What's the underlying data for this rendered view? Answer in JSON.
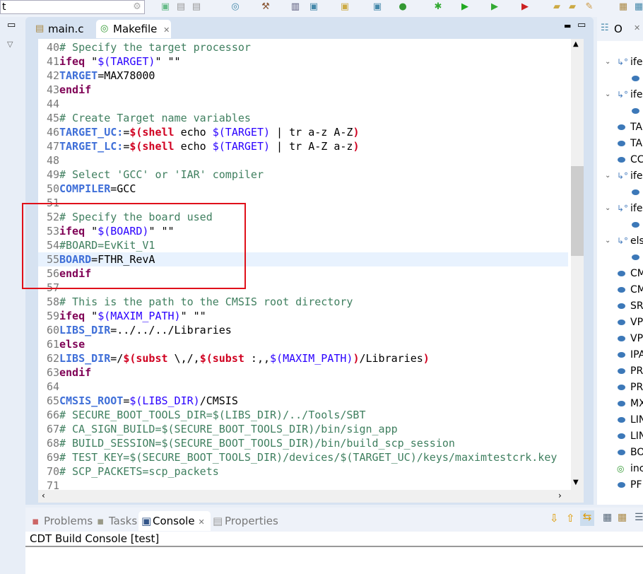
{
  "toolbar": {
    "quick_access_value": "t"
  },
  "editor": {
    "tabs": [
      {
        "label": "main.c",
        "icon": "c-file-icon"
      },
      {
        "label": "Makefile",
        "icon": "makefile-icon",
        "active": true
      }
    ],
    "current_line": 55,
    "lines": [
      {
        "n": "40",
        "t": [
          [
            "cmt",
            "# Specify the target processor"
          ]
        ]
      },
      {
        "n": "41",
        "t": [
          [
            "kw",
            "ifeq"
          ],
          [
            "txt",
            " \""
          ],
          [
            "ref",
            "$(TARGET)"
          ],
          [
            "txt",
            "\" \"\""
          ]
        ]
      },
      {
        "n": "42",
        "t": [
          [
            "var",
            "TARGET"
          ],
          [
            "txt",
            "=MAX78000"
          ]
        ]
      },
      {
        "n": "43",
        "t": [
          [
            "kw",
            "endif"
          ]
        ]
      },
      {
        "n": "44",
        "t": []
      },
      {
        "n": "45",
        "t": [
          [
            "cmt",
            "# Create Target name variables"
          ]
        ]
      },
      {
        "n": "46",
        "t": [
          [
            "var",
            "TARGET_UC:"
          ],
          [
            "txt",
            "="
          ],
          [
            "fn",
            "$(shell"
          ],
          [
            "txt",
            " echo "
          ],
          [
            "ref",
            "$(TARGET)"
          ],
          [
            "txt",
            " | tr a-z A-Z"
          ],
          [
            "fn",
            ")"
          ]
        ]
      },
      {
        "n": "47",
        "t": [
          [
            "var",
            "TARGET_LC:"
          ],
          [
            "txt",
            "="
          ],
          [
            "fn",
            "$(shell"
          ],
          [
            "txt",
            " echo "
          ],
          [
            "ref",
            "$(TARGET)"
          ],
          [
            "txt",
            " | tr A-Z a-z"
          ],
          [
            "fn",
            ")"
          ]
        ]
      },
      {
        "n": "48",
        "t": []
      },
      {
        "n": "49",
        "t": [
          [
            "cmt",
            "# Select 'GCC' or 'IAR' compiler"
          ]
        ]
      },
      {
        "n": "50",
        "t": [
          [
            "var",
            "COMPILER"
          ],
          [
            "txt",
            "=GCC"
          ]
        ]
      },
      {
        "n": "51",
        "t": []
      },
      {
        "n": "52",
        "t": [
          [
            "cmt",
            "# Specify the board used"
          ]
        ]
      },
      {
        "n": "53",
        "t": [
          [
            "kw",
            "ifeq"
          ],
          [
            "txt",
            " \""
          ],
          [
            "ref",
            "$(BOARD)"
          ],
          [
            "txt",
            "\" \"\""
          ]
        ]
      },
      {
        "n": "54",
        "t": [
          [
            "cmt",
            "#BOARD=EvKit_V1"
          ]
        ]
      },
      {
        "n": "55",
        "t": [
          [
            "var",
            "BOARD"
          ],
          [
            "txt",
            "=FTHR_RevA"
          ]
        ]
      },
      {
        "n": "56",
        "t": [
          [
            "kw",
            "endif"
          ]
        ]
      },
      {
        "n": "57",
        "t": []
      },
      {
        "n": "58",
        "t": [
          [
            "cmt",
            "# This is the path to the CMSIS root directory"
          ]
        ]
      },
      {
        "n": "59",
        "t": [
          [
            "kw",
            "ifeq"
          ],
          [
            "txt",
            " \""
          ],
          [
            "ref",
            "$(MAXIM_PATH)"
          ],
          [
            "txt",
            "\" \"\""
          ]
        ]
      },
      {
        "n": "60",
        "t": [
          [
            "var",
            "LIBS_DIR"
          ],
          [
            "txt",
            "=../../../Libraries"
          ]
        ]
      },
      {
        "n": "61",
        "t": [
          [
            "kw",
            "else"
          ]
        ]
      },
      {
        "n": "62",
        "t": [
          [
            "var",
            "LIBS_DIR"
          ],
          [
            "txt",
            "=/"
          ],
          [
            "fn",
            "$(subst"
          ],
          [
            "txt",
            " \\,/,"
          ],
          [
            "fn",
            "$(subst"
          ],
          [
            "txt",
            " :,,"
          ],
          [
            "ref",
            "$(MAXIM_PATH)"
          ],
          [
            "fn",
            ")"
          ],
          [
            "txt",
            "/Libraries"
          ],
          [
            "fn",
            ")"
          ]
        ]
      },
      {
        "n": "63",
        "t": [
          [
            "kw",
            "endif"
          ]
        ]
      },
      {
        "n": "64",
        "t": []
      },
      {
        "n": "65",
        "t": [
          [
            "var",
            "CMSIS_ROOT"
          ],
          [
            "txt",
            "="
          ],
          [
            "ref",
            "$(LIBS_DIR)"
          ],
          [
            "txt",
            "/CMSIS"
          ]
        ]
      },
      {
        "n": "66",
        "t": [
          [
            "cmt",
            "# SECURE_BOOT_TOOLS_DIR=$(LIBS_DIR)/../Tools/SBT"
          ]
        ]
      },
      {
        "n": "67",
        "t": [
          [
            "cmt",
            "# CA_SIGN_BUILD=$(SECURE_BOOT_TOOLS_DIR)/bin/sign_app"
          ]
        ]
      },
      {
        "n": "68",
        "t": [
          [
            "cmt",
            "# BUILD_SESSION=$(SECURE_BOOT_TOOLS_DIR)/bin/build_scp_session"
          ]
        ]
      },
      {
        "n": "69",
        "t": [
          [
            "cmt",
            "# TEST_KEY=$(SECURE_BOOT_TOOLS_DIR)/devices/$(TARGET_UC)/keys/maximtestcrk.key"
          ]
        ]
      },
      {
        "n": "70",
        "t": [
          [
            "cmt",
            "# SCP_PACKETS=scp_packets"
          ]
        ]
      },
      {
        "n": "71",
        "t": []
      }
    ]
  },
  "outline": {
    "title": "O",
    "items": [
      {
        "type": "cond",
        "label": "ife"
      },
      {
        "type": "var",
        "label": ""
      },
      {
        "type": "cond",
        "label": "ife"
      },
      {
        "type": "var",
        "label": ""
      },
      {
        "type": "var",
        "label": "TA",
        "top": true
      },
      {
        "type": "var",
        "label": "TA",
        "top": true
      },
      {
        "type": "var",
        "label": "CC",
        "top": true
      },
      {
        "type": "cond",
        "label": "ife"
      },
      {
        "type": "var",
        "label": ""
      },
      {
        "type": "cond",
        "label": "ife"
      },
      {
        "type": "var",
        "label": ""
      },
      {
        "type": "cond",
        "label": "els"
      },
      {
        "type": "var",
        "label": ""
      },
      {
        "type": "var",
        "label": "CM",
        "top": true
      },
      {
        "type": "var",
        "label": "CM",
        "top": true
      },
      {
        "type": "var",
        "label": "SR",
        "top": true
      },
      {
        "type": "var",
        "label": "VP",
        "top": true
      },
      {
        "type": "var",
        "label": "VP",
        "top": true
      },
      {
        "type": "var",
        "label": "IPA",
        "top": true
      },
      {
        "type": "var",
        "label": "PR",
        "top": true
      },
      {
        "type": "var",
        "label": "PR",
        "top": true
      },
      {
        "type": "var",
        "label": "MX",
        "top": true
      },
      {
        "type": "var",
        "label": "LIN",
        "top": true
      },
      {
        "type": "var",
        "label": "LIN",
        "top": true
      },
      {
        "type": "var",
        "label": "BO",
        "top": true
      },
      {
        "type": "include",
        "label": "inc",
        "top": true
      },
      {
        "type": "var",
        "label": "PF",
        "top": true
      }
    ]
  },
  "bottom": {
    "tabs": [
      {
        "label": "Problems"
      },
      {
        "label": "Tasks"
      },
      {
        "label": "Console",
        "active": true
      },
      {
        "label": "Properties"
      }
    ],
    "console_title": "CDT Build Console [test]"
  },
  "colors": {
    "highlight_box": "#e0101a",
    "comment": "#3f7f5f",
    "keyword": "#7f0055",
    "variable": "#3f6fd8",
    "reference": "#2a00ff",
    "function": "#d00020"
  }
}
